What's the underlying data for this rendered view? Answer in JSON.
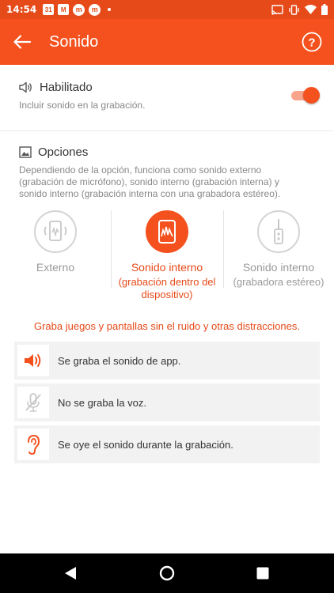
{
  "status_bar": {
    "time": "14:54",
    "calendar_badge": "31",
    "mail_badge": "M",
    "app_badge_1": "m",
    "app_badge_2": "m"
  },
  "app_bar": {
    "title": "Sonido",
    "help_label": "?"
  },
  "enabled_section": {
    "title": "Habilitado",
    "subtitle": "Incluir sonido en la grabación.",
    "toggle_on": true
  },
  "options_section": {
    "title": "Opciones",
    "description": "Dependiendo de la opción, funciona como sonido externo (grabación de micrófono), sonido interno (grabación interna) y sonido interno (grabación interna con una grabadora estéreo).",
    "options": [
      {
        "label": "Externo",
        "sublabel": ""
      },
      {
        "label": "Sonido interno",
        "sublabel": "(grabación dentro del dispositivo)",
        "selected": true
      },
      {
        "label": "Sonido interno",
        "sublabel": "(grabadora estéreo)"
      }
    ]
  },
  "tagline": "Graba juegos y pantallas sin el ruido y otras distracciones.",
  "features": [
    {
      "icon": "speaker-icon",
      "text": "Se graba el sonido de app."
    },
    {
      "icon": "mic-off-icon",
      "text": "No se graba la voz."
    },
    {
      "icon": "ear-icon",
      "text": "Se oye el sonido durante la grabación."
    }
  ],
  "colors": {
    "accent": "#f4511e",
    "status_bar": "#e64a19",
    "inactive": "#b8b8b8"
  }
}
